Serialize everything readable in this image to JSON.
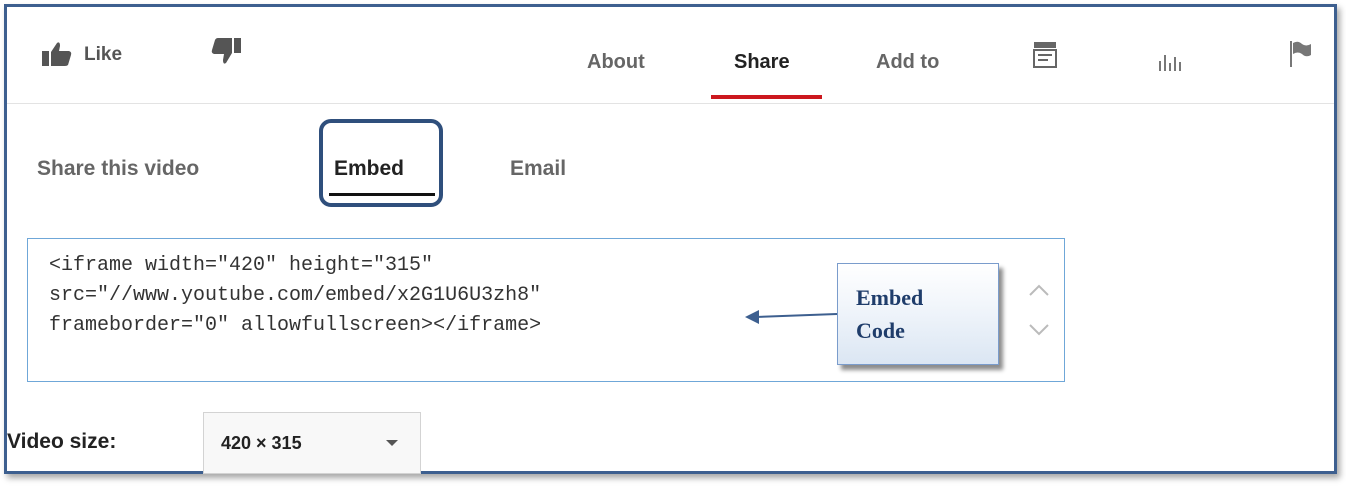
{
  "actions": {
    "like_label": "Like"
  },
  "tabs": [
    {
      "label": "About"
    },
    {
      "label": "Share"
    },
    {
      "label": "Add to"
    }
  ],
  "share_tabs": [
    {
      "label": "Share this video"
    },
    {
      "label": "Embed"
    },
    {
      "label": "Email"
    }
  ],
  "embed_code": {
    "lines": [
      "<iframe width=\"420\" height=\"315\"",
      "src=\"//www.youtube.com/embed/x2G1U6U3zh8\"",
      "frameborder=\"0\" allowfullscreen></iframe>"
    ]
  },
  "callout": {
    "line1": "Embed",
    "line2": "Code"
  },
  "video_size": {
    "label": "Video size:",
    "value": "420 × 315"
  },
  "icons": {
    "like": "thumbs-up-icon",
    "dislike": "thumbs-down-icon",
    "transcript": "transcript-icon",
    "stats": "statistics-icon",
    "report": "flag-icon"
  },
  "colors": {
    "active_tab_underline": "#cc181e",
    "frame_border": "#3d5f8f",
    "callout_text": "#1f3d6b"
  }
}
